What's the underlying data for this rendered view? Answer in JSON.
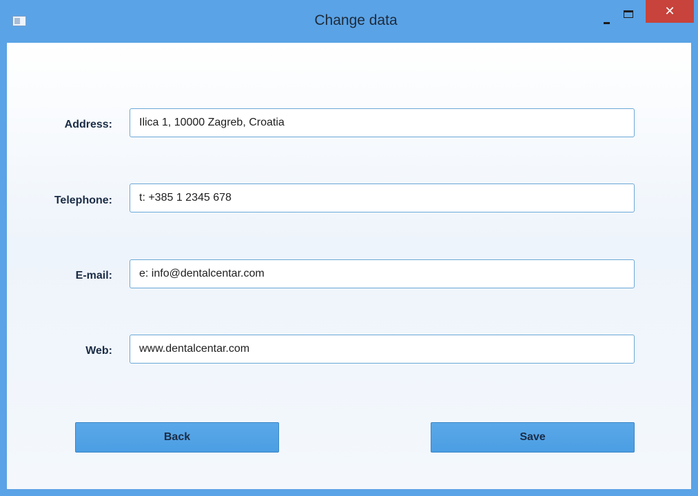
{
  "window": {
    "title": "Change data",
    "close_label": "✕"
  },
  "form": {
    "address": {
      "label": "Address:",
      "value": "Ilica 1, 10000 Zagreb, Croatia"
    },
    "telephone": {
      "label": "Telephone:",
      "value": "t: +385 1 2345 678"
    },
    "email": {
      "label": "E-mail:",
      "value": "e: info@dentalcentar.com"
    },
    "web": {
      "label": "Web:",
      "value": "www.dentalcentar.com"
    }
  },
  "buttons": {
    "back_label": "Back",
    "save_label": "Save"
  },
  "colors": {
    "titlebar": "#5aa3e6",
    "close": "#c7433b",
    "button": "#4b9ee3",
    "field_border": "#6aa7d6"
  }
}
